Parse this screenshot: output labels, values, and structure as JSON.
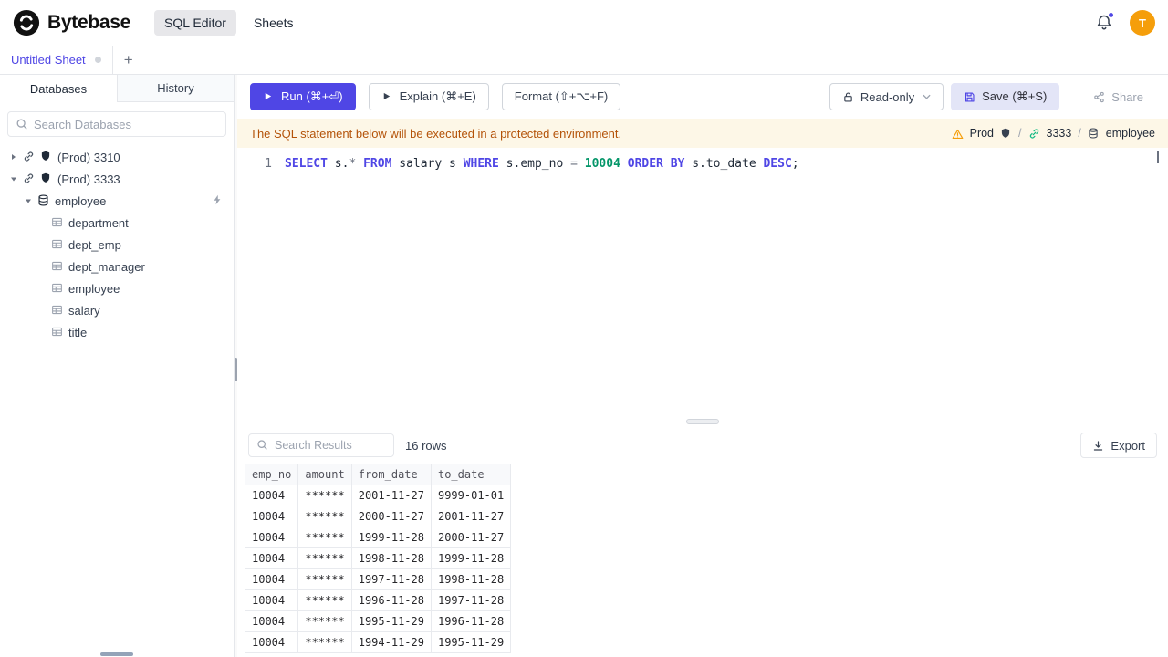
{
  "colors": {
    "accent": "#4f46e5",
    "warning_bg": "#fdf7e7",
    "warning_text": "#b45309",
    "avatar_bg": "#f59e0b",
    "sql_keyword": "#4f46e5",
    "sql_number": "#059669",
    "connection_ok": "#10b981"
  },
  "icons": {
    "logo": "bytebase-logo",
    "bell": "bell-icon",
    "search": "search-icon",
    "caret_collapsed": "caret-right-icon",
    "caret_expanded": "caret-down-icon",
    "instance": "connection-icon",
    "environment": "shield-icon",
    "database": "database-icon",
    "table": "table-icon",
    "quick_connect": "bolt-icon",
    "run": "play-icon",
    "readonly": "lock-icon",
    "dropdown": "chevron-down-icon",
    "save": "save-icon",
    "share": "share-icon",
    "warning": "warning-icon",
    "export": "download-icon",
    "add_tab": "+"
  },
  "header": {
    "brand": "Bytebase",
    "nav": [
      {
        "label": "SQL Editor",
        "active": true
      },
      {
        "label": "Sheets",
        "active": false
      }
    ],
    "notifications_unread": true,
    "avatar_letter": "T"
  },
  "sheetbar": {
    "active_tab": "Untitled Sheet",
    "add_label": "+"
  },
  "sidebar": {
    "tabs": [
      {
        "label": "Databases",
        "active": true
      },
      {
        "label": "History",
        "active": false
      }
    ],
    "search_placeholder": "Search Databases",
    "tree": [
      {
        "label": "(Prod) 3310",
        "depth": 0,
        "type": "instance",
        "expanded": false
      },
      {
        "label": "(Prod) 3333",
        "depth": 0,
        "type": "instance",
        "expanded": true
      },
      {
        "label": "employee",
        "depth": 1,
        "type": "database",
        "expanded": true,
        "action": "bolt"
      },
      {
        "label": "department",
        "depth": 2,
        "type": "table"
      },
      {
        "label": "dept_emp",
        "depth": 2,
        "type": "table"
      },
      {
        "label": "dept_manager",
        "depth": 2,
        "type": "table"
      },
      {
        "label": "employee",
        "depth": 2,
        "type": "table"
      },
      {
        "label": "salary",
        "depth": 2,
        "type": "table"
      },
      {
        "label": "title",
        "depth": 2,
        "type": "table"
      }
    ]
  },
  "toolbar": {
    "run": "Run (⌘+⏎)",
    "explain": "Explain (⌘+E)",
    "format": "Format (⇧+⌥+F)",
    "readonly": "Read-only",
    "save": "Save (⌘+S)",
    "share": "Share"
  },
  "banner": {
    "message": "The SQL statement below will be executed in a protected environment.",
    "environment": "Prod",
    "separator": "/",
    "instance": "3333",
    "database": "employee"
  },
  "editor": {
    "line_number": "1",
    "sql": "SELECT s.* FROM salary s WHERE s.emp_no = 10004 ORDER BY s.to_date DESC;",
    "tokens": [
      {
        "t": "SELECT",
        "c": "keyword"
      },
      {
        "t": " s.",
        "c": "plain"
      },
      {
        "t": "*",
        "c": "operator"
      },
      {
        "t": " ",
        "c": "plain"
      },
      {
        "t": "FROM",
        "c": "keyword"
      },
      {
        "t": " salary s ",
        "c": "plain"
      },
      {
        "t": "WHERE",
        "c": "keyword"
      },
      {
        "t": " s.emp_no ",
        "c": "plain"
      },
      {
        "t": "=",
        "c": "operator"
      },
      {
        "t": " ",
        "c": "plain"
      },
      {
        "t": "10004",
        "c": "number"
      },
      {
        "t": " ",
        "c": "plain"
      },
      {
        "t": "ORDER BY",
        "c": "keyword"
      },
      {
        "t": " s.to_date ",
        "c": "plain"
      },
      {
        "t": "DESC",
        "c": "keyword"
      },
      {
        "t": ";",
        "c": "plain"
      }
    ]
  },
  "results": {
    "search_placeholder": "Search Results",
    "row_count": "16 rows",
    "export_label": "Export",
    "columns": [
      "emp_no",
      "amount",
      "from_date",
      "to_date"
    ],
    "rows": [
      [
        "10004",
        "******",
        "2001-11-27",
        "9999-01-01"
      ],
      [
        "10004",
        "******",
        "2000-11-27",
        "2001-11-27"
      ],
      [
        "10004",
        "******",
        "1999-11-28",
        "2000-11-27"
      ],
      [
        "10004",
        "******",
        "1998-11-28",
        "1999-11-28"
      ],
      [
        "10004",
        "******",
        "1997-11-28",
        "1998-11-28"
      ],
      [
        "10004",
        "******",
        "1996-11-28",
        "1997-11-28"
      ],
      [
        "10004",
        "******",
        "1995-11-29",
        "1996-11-28"
      ],
      [
        "10004",
        "******",
        "1994-11-29",
        "1995-11-29"
      ]
    ]
  }
}
